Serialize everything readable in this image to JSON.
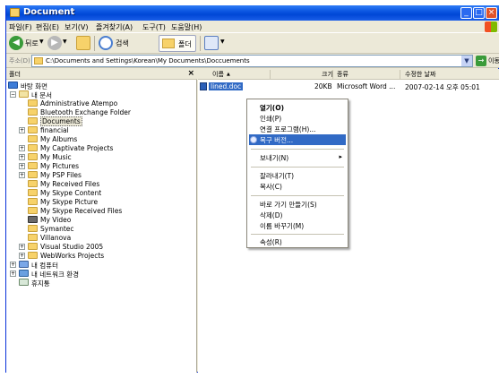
{
  "window": {
    "title": "Document",
    "buttons": {
      "minimize": "_",
      "maximize": "□",
      "close": "×"
    }
  },
  "menubar": {
    "items": [
      "파일(F)",
      "편집(E)",
      "보기(V)",
      "즐겨찾기(A)",
      "도구(T)",
      "도움말(H)"
    ]
  },
  "toolbar": {
    "back_label": "뒤로",
    "search_label": "검색",
    "folders_label": "폴더"
  },
  "addressbar": {
    "label": "주소(D)",
    "path": "C:\\Documents and Settings\\Korean\\My Documents\\Doccuements",
    "go_label": "이동"
  },
  "folders_pane": {
    "title": "폴더",
    "close_glyph": "×",
    "tree": [
      {
        "label": "바탕 화면",
        "icon": "desktop-icon",
        "expander": ""
      },
      {
        "label": "내 문서",
        "icon": "my-documents-icon",
        "expander": "−"
      },
      {
        "label": "Administrative Atempo",
        "icon": "folder-icon",
        "expander": ""
      },
      {
        "label": "Bluetooth Exchange Folder",
        "icon": "folder-icon",
        "expander": ""
      },
      {
        "label": "Documents",
        "icon": "folder-icon",
        "expander": "",
        "selected": true
      },
      {
        "label": "financial",
        "icon": "folder-icon",
        "expander": "+"
      },
      {
        "label": "My Albums",
        "icon": "folder-icon",
        "expander": ""
      },
      {
        "label": "My Captivate Projects",
        "icon": "folder-icon",
        "expander": "+"
      },
      {
        "label": "My Music",
        "icon": "music-folder-icon",
        "expander": "+"
      },
      {
        "label": "My Pictures",
        "icon": "pictures-folder-icon",
        "expander": "+"
      },
      {
        "label": "My PSP Files",
        "icon": "folder-icon",
        "expander": "+"
      },
      {
        "label": "My Received Files",
        "icon": "folder-icon",
        "expander": ""
      },
      {
        "label": "My Skype Content",
        "icon": "folder-icon",
        "expander": ""
      },
      {
        "label": "My Skype Picture",
        "icon": "folder-icon",
        "expander": ""
      },
      {
        "label": "My Skype Received Files",
        "icon": "folder-icon",
        "expander": ""
      },
      {
        "label": "My Video",
        "icon": "video-folder-icon",
        "expander": ""
      },
      {
        "label": "Symantec",
        "icon": "folder-icon",
        "expander": ""
      },
      {
        "label": "Villanova",
        "icon": "folder-icon",
        "expander": ""
      },
      {
        "label": "Visual Studio 2005",
        "icon": "folder-icon",
        "expander": "+"
      },
      {
        "label": "WebWorks Projects",
        "icon": "folder-icon",
        "expander": "+"
      },
      {
        "label": "내 컴퓨터",
        "icon": "my-computer-icon",
        "expander": "+"
      },
      {
        "label": "내 네트워크 환경",
        "icon": "network-icon",
        "expander": "+"
      },
      {
        "label": "휴지통",
        "icon": "recycle-bin-icon",
        "expander": ""
      }
    ]
  },
  "list_pane": {
    "columns": {
      "name": "이름",
      "sort_glyph": "▲",
      "size": "크기",
      "type": "종류",
      "modified": "수정한 날짜"
    },
    "file": {
      "name": "lined.doc",
      "size": "20KB",
      "type": "Microsoft Word ...",
      "modified": "2007-02-14 오후 05:01"
    }
  },
  "context_menu": {
    "items": [
      {
        "label": "열기(O)",
        "bold": true
      },
      {
        "label": "인쇄(P)"
      },
      {
        "label": "연결 프로그램(H)..."
      },
      {
        "label": "복구 버전...",
        "highlighted": true,
        "icon": "restore-icon"
      },
      {
        "divider": true
      },
      {
        "label": "보내기(N)",
        "submenu": true
      },
      {
        "divider": true
      },
      {
        "label": "잘라내기(T)"
      },
      {
        "label": "복사(C)"
      },
      {
        "divider": true
      },
      {
        "label": "바로 가기 만들기(S)"
      },
      {
        "label": "삭제(D)"
      },
      {
        "label": "이름 바꾸기(M)"
      },
      {
        "divider": true
      },
      {
        "label": "속성(R)"
      }
    ],
    "submenu_glyph": "▸"
  },
  "colors": {
    "titlebar": "#0a55e0",
    "selection": "#316ac5",
    "chrome": "#ece9d8"
  }
}
